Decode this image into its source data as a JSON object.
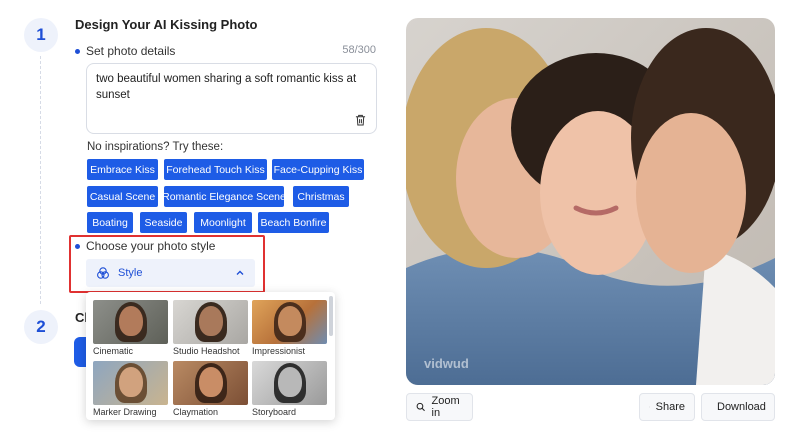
{
  "steps": {
    "one": "1",
    "two": "2"
  },
  "section1": {
    "title": "Design Your AI Kissing Photo",
    "details_label": "Set photo details",
    "char_counter": "58/300",
    "prompt_value": "two beautiful women sharing a soft romantic kiss at sunset",
    "inspirations_label": "No inspirations?  Try these:",
    "chips": [
      "Embrace Kiss",
      "Forehead Touch Kiss",
      "Face-Cupping Kiss",
      "Casual Scene",
      "Romantic Elegance Scene",
      "Christmas",
      "Boating",
      "Seaside",
      "Moonlight",
      "Beach Bonfire"
    ],
    "style_label": "Choose your photo style",
    "style_select_value": "Style"
  },
  "section2": {
    "title_fragment": "Cl"
  },
  "style_options": [
    "Cinematic",
    "Studio Headshot",
    "Impressionist",
    "Marker Drawing",
    "Claymation",
    "Storyboard"
  ],
  "preview": {
    "watermark": "vidwud"
  },
  "actions": {
    "zoom": "Zoom in",
    "share": "Share",
    "download": "Download"
  },
  "colors": {
    "accent": "#1e5ce6",
    "highlight": "#e03131"
  }
}
